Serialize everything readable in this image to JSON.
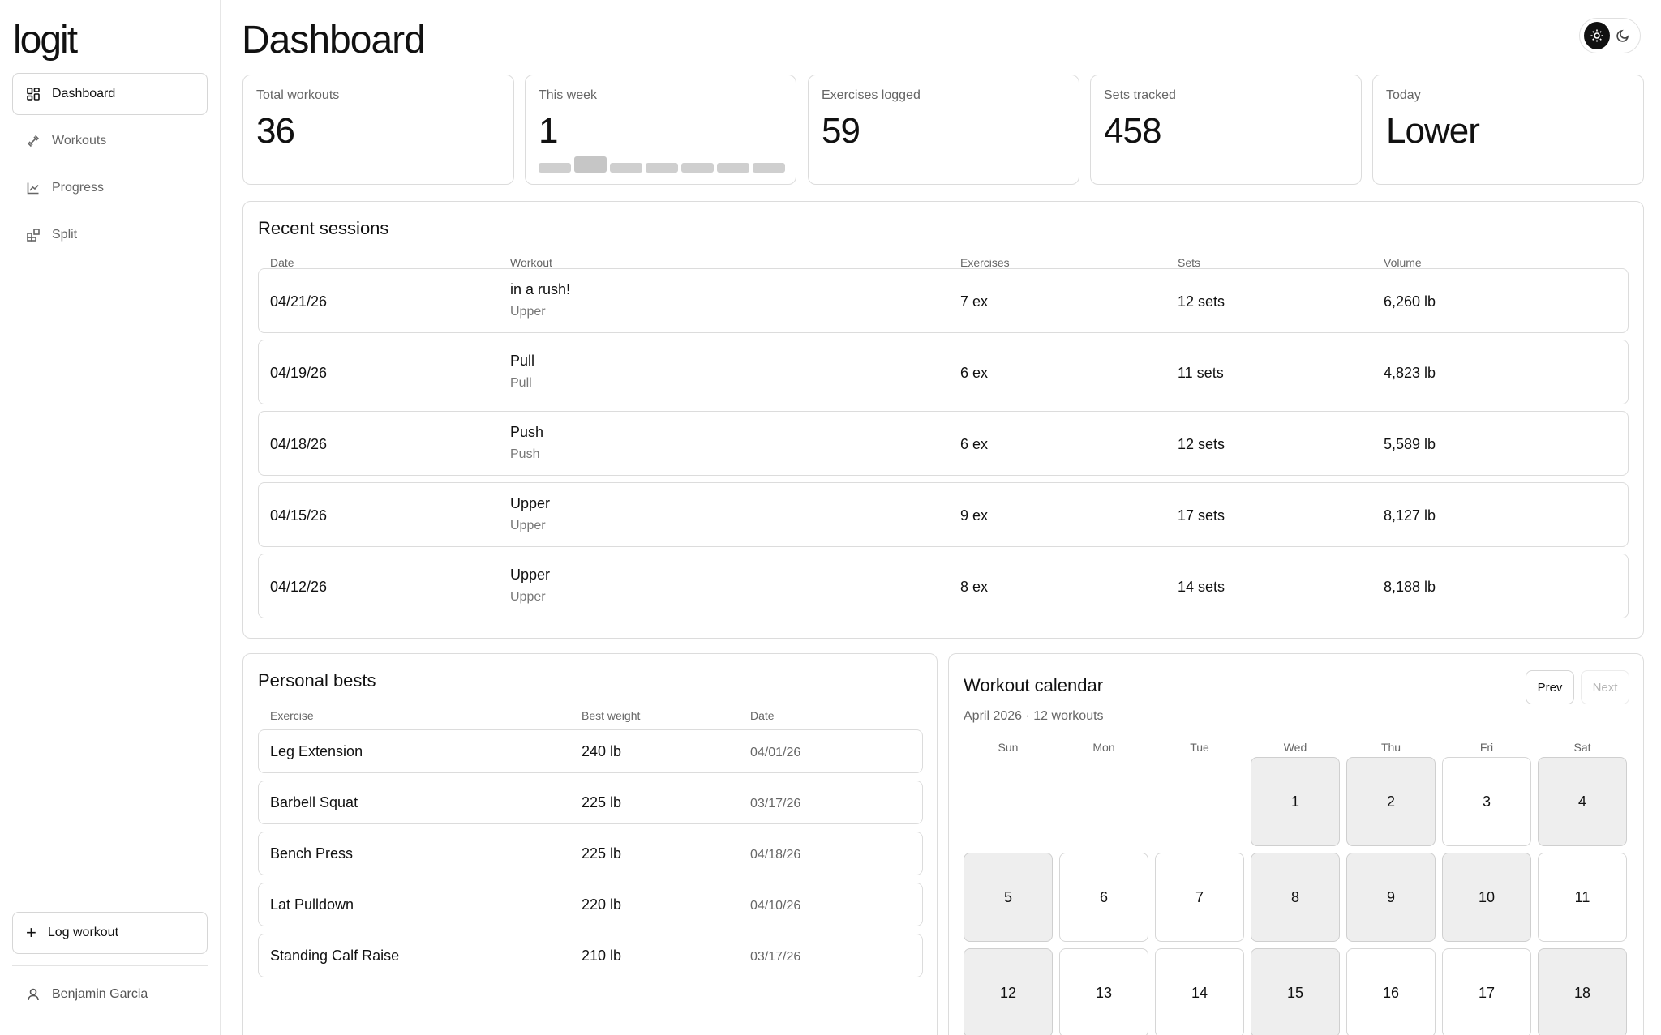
{
  "app": {
    "logo": "logit"
  },
  "sidebar": {
    "items": [
      {
        "label": "Dashboard",
        "icon": "dashboard-icon",
        "active": true
      },
      {
        "label": "Workouts",
        "icon": "dumbbell-icon",
        "active": false
      },
      {
        "label": "Progress",
        "icon": "line-chart-icon",
        "active": false
      },
      {
        "label": "Split",
        "icon": "blocks-icon",
        "active": false
      }
    ],
    "log_workout": "Log workout",
    "user_name": "Benjamin Garcia"
  },
  "header": {
    "title": "Dashboard",
    "theme": {
      "light_icon": "sun-icon",
      "dark_icon": "moon-icon",
      "selected": "light"
    }
  },
  "stats": [
    {
      "label": "Total workouts",
      "value": "36"
    },
    {
      "label": "This week",
      "value": "1",
      "week_activity": [
        0,
        1,
        0,
        0,
        0,
        0,
        0
      ]
    },
    {
      "label": "Exercises logged",
      "value": "59"
    },
    {
      "label": "Sets tracked",
      "value": "458"
    },
    {
      "label": "Today",
      "value": "Lower"
    }
  ],
  "recent": {
    "title": "Recent sessions",
    "columns": [
      "Date",
      "Workout",
      "Exercises",
      "Sets",
      "Volume"
    ],
    "rows": [
      {
        "date": "04/21/26",
        "name": "in a rush!",
        "type": "Upper",
        "exercises": "7 ex",
        "sets": "12 sets",
        "volume": "6,260 lb"
      },
      {
        "date": "04/19/26",
        "name": "Pull",
        "type": "Pull",
        "exercises": "6 ex",
        "sets": "11 sets",
        "volume": "4,823 lb"
      },
      {
        "date": "04/18/26",
        "name": "Push",
        "type": "Push",
        "exercises": "6 ex",
        "sets": "12 sets",
        "volume": "5,589 lb"
      },
      {
        "date": "04/15/26",
        "name": "Upper",
        "type": "Upper",
        "exercises": "9 ex",
        "sets": "17 sets",
        "volume": "8,127 lb"
      },
      {
        "date": "04/12/26",
        "name": "Upper",
        "type": "Upper",
        "exercises": "8 ex",
        "sets": "14 sets",
        "volume": "8,188 lb"
      }
    ]
  },
  "bests": {
    "title": "Personal bests",
    "columns": [
      "Exercise",
      "Best weight",
      "Date"
    ],
    "rows": [
      {
        "exercise": "Leg Extension",
        "weight": "240 lb",
        "date": "04/01/26"
      },
      {
        "exercise": "Barbell Squat",
        "weight": "225 lb",
        "date": "03/17/26"
      },
      {
        "exercise": "Bench Press",
        "weight": "225 lb",
        "date": "04/18/26"
      },
      {
        "exercise": "Lat Pulldown",
        "weight": "220 lb",
        "date": "04/10/26"
      },
      {
        "exercise": "Standing Calf Raise",
        "weight": "210 lb",
        "date": "03/17/26"
      }
    ]
  },
  "calendar": {
    "title": "Workout calendar",
    "subtitle": "April 2026 · 12 workouts",
    "prev": "Prev",
    "next": "Next",
    "weekdays": [
      "Sun",
      "Mon",
      "Tue",
      "Wed",
      "Thu",
      "Fri",
      "Sat"
    ],
    "first_weekday": 3,
    "days": [
      {
        "day": "1",
        "worked": true
      },
      {
        "day": "2",
        "worked": true
      },
      {
        "day": "3",
        "worked": false
      },
      {
        "day": "4",
        "worked": true
      },
      {
        "day": "5",
        "worked": true
      },
      {
        "day": "6",
        "worked": false
      },
      {
        "day": "7",
        "worked": false
      },
      {
        "day": "8",
        "worked": true
      },
      {
        "day": "9",
        "worked": true
      },
      {
        "day": "10",
        "worked": true
      },
      {
        "day": "11",
        "worked": false
      },
      {
        "day": "12",
        "worked": true
      },
      {
        "day": "13",
        "worked": false
      },
      {
        "day": "14",
        "worked": false
      },
      {
        "day": "15",
        "worked": true
      },
      {
        "day": "16",
        "worked": false
      },
      {
        "day": "17",
        "worked": false
      },
      {
        "day": "18",
        "worked": true
      }
    ]
  }
}
